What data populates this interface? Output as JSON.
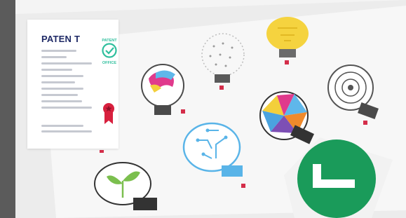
{
  "patent_card": {
    "title": "PATEN T",
    "seal_text_top": "PATENT",
    "seal_text_bottom": "OFFICE",
    "seal_icon": "check-circle-icon",
    "ribbon_icon": "award-ribbon-icon"
  },
  "photo": {
    "subject": "lightbulb-illustrations-on-paper",
    "check_badge_icon": "check-icon"
  },
  "colors": {
    "title": "#1f2a66",
    "seal": "#2fbf9d",
    "ribbon": "#d8203e",
    "check_badge": "#1a9b5a",
    "text_lines": "#c6c9d1"
  }
}
